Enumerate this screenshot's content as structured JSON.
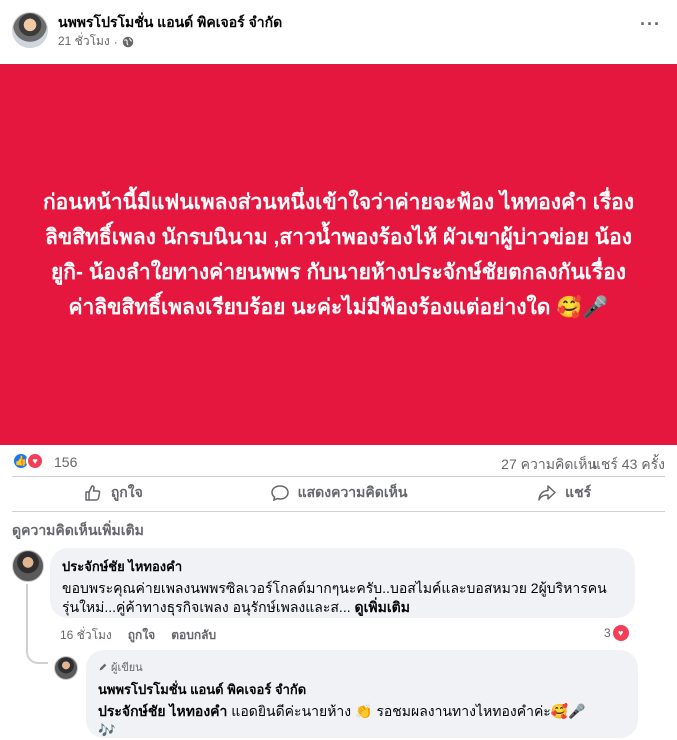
{
  "post": {
    "page_name": "นพพรโปรโมชั่น แอนด์ พิคเจอร์ จำกัด",
    "time": "21 ชั่วโมง",
    "separator": "·",
    "privacy_icon": "globe-icon",
    "more_label": "···",
    "banner_color": "#e5173e",
    "banner_text": "ก่อนหน้านี้มีแฟนเพลงส่วนหนึ่งเข้าใจว่าค่ายจะฟ้อง ไหทองคำ เรื่อง ลิขสิทธิ์เพลง นักรบนินาม ,สาวน้ำพองร้องไห้ ผัวเขาผู้บ่าวข่อย น้องยูกิ- น้องลำใยทางค่ายนพพร กับนายห้างประจักษ์ชัยตกลงกันเรื่องค่าลิขสิทธิ์เพลงเรียบร้อย นะค่ะไม่มีฟ้องร้องแต่อย่างใด 🥰🎤"
  },
  "stats": {
    "reactions": "156",
    "comments": "27 ความคิดเห็น",
    "shares": "แชร์ 43 ครั้ง"
  },
  "actions": {
    "like": "ถูกใจ",
    "comment": "แสดงความคิดเห็น",
    "share": "แชร์"
  },
  "more_comments": "ดูความคิดเห็นเพิ่มเติม",
  "comments": [
    {
      "name": "ประจักษ์ชัย ไหทองคำ",
      "text": "ขอบพระคุณค่ายเพลงนพพรซิลเวอร์โกลด์มากๆนะครับ..บอสไมค์และบอสหมวย 2ผู้บริหารคน",
      "text2": "รุ่นใหม่...คู่ค้าทางธุรกิจเพลง อนุรักษ์เพลงและส...",
      "see_more": "ดูเพิ่มเติม",
      "time": "16 ชั่วโมง",
      "like": "ถูกใจ",
      "reply": "ตอบกลับ",
      "reaction_count": "3"
    },
    {
      "badge": "ผู้เขียน",
      "name": "นพพรโปรโมชั่น แอนด์ พิคเจอร์ จำกัด",
      "mention": "ประจักษ์ชัย ไหทองคำ",
      "text": " แอดยินดีค่ะนายห้าง 👏 รอชมผลงานทางไหทองคำค่ะ🥰🎤",
      "text2": "🎶"
    }
  ]
}
